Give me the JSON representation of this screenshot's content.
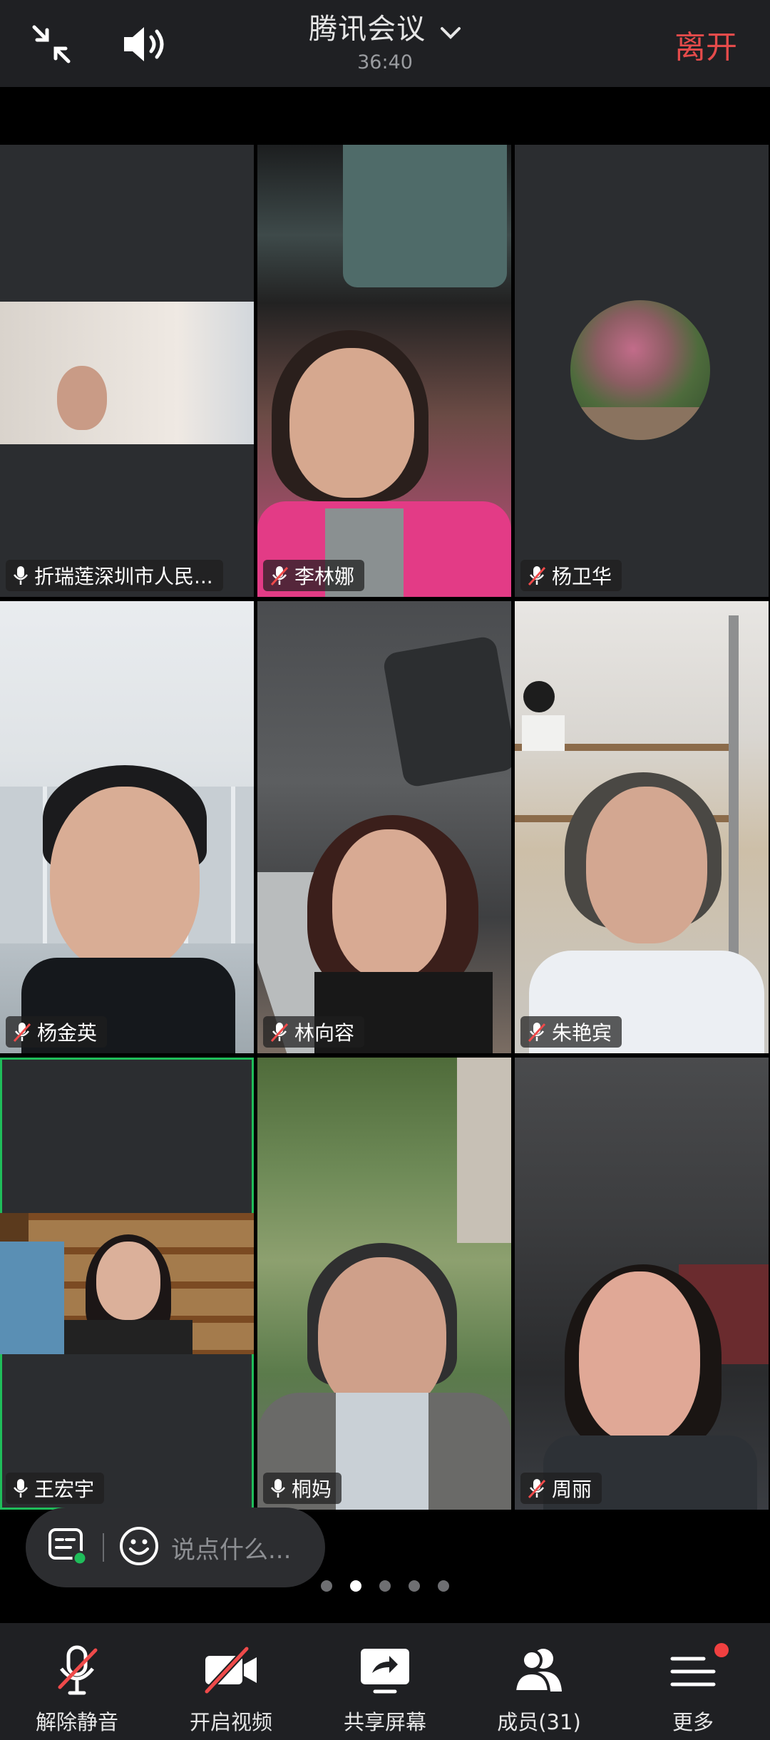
{
  "header": {
    "title": "腾讯会议",
    "timer": "36:40",
    "leave_label": "离开"
  },
  "participants": [
    {
      "name": "折瑞莲深圳市人民...",
      "muted": false
    },
    {
      "name": "李林娜",
      "muted": true
    },
    {
      "name": "杨卫华",
      "muted": true
    },
    {
      "name": "杨金英",
      "muted": true
    },
    {
      "name": "林向容",
      "muted": true
    },
    {
      "name": "朱艳宾",
      "muted": true
    },
    {
      "name": "王宏宇",
      "muted": false
    },
    {
      "name": "桐妈",
      "muted": false
    },
    {
      "name": "周丽",
      "muted": true
    }
  ],
  "chat": {
    "placeholder": "说点什么..."
  },
  "pager": {
    "current": 2,
    "total": 5
  },
  "toolbar": {
    "unmute_label": "解除静音",
    "video_label": "开启视频",
    "share_label": "共享屏幕",
    "members_label": "成员(31)",
    "more_label": "更多"
  }
}
